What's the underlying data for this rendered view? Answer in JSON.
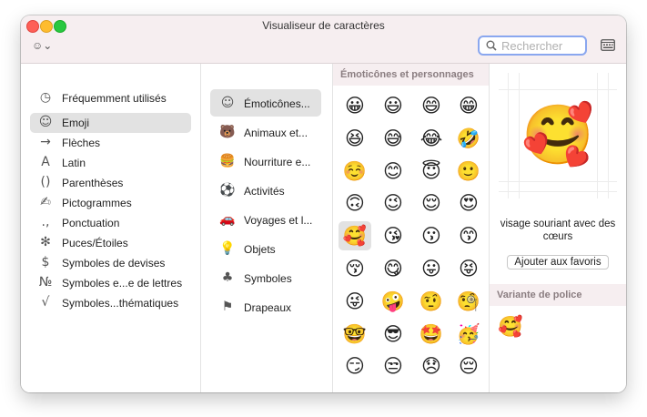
{
  "window": {
    "title": "Visualiseur de caractères"
  },
  "toolbar": {
    "emoji_menu": "☺⌄",
    "search_placeholder": "Rechercher",
    "search_value": ""
  },
  "categories": [
    {
      "icon": "◷",
      "label": "Fréquemment utilisés"
    },
    {
      "icon": "☺",
      "label": "Emoji"
    },
    {
      "icon": "→",
      "label": "Flèches"
    },
    {
      "icon": "A",
      "label": "Latin"
    },
    {
      "icon": "()",
      "label": "Parenthèses"
    },
    {
      "icon": "✍",
      "label": "Pictogrammes"
    },
    {
      "icon": ".,",
      "label": "Ponctuation"
    },
    {
      "icon": "✻",
      "label": "Puces/Étoiles"
    },
    {
      "icon": "$",
      "label": "Symboles de devises"
    },
    {
      "icon": "№",
      "label": "Symboles e...e de lettres"
    },
    {
      "icon": "√",
      "label": "Symboles...thématiques"
    }
  ],
  "subcategories": [
    {
      "icon": "☺",
      "label": "Émoticônes..."
    },
    {
      "icon": "🐻",
      "label": "Animaux et..."
    },
    {
      "icon": "🍔",
      "label": "Nourriture e..."
    },
    {
      "icon": "⚽",
      "label": "Activités"
    },
    {
      "icon": "🚗",
      "label": "Voyages et l..."
    },
    {
      "icon": "💡",
      "label": "Objets"
    },
    {
      "icon": "♣",
      "label": "Symboles"
    },
    {
      "icon": "⚑",
      "label": "Drapeaux"
    }
  ],
  "grid": {
    "section_title": "Émoticônes et personnages",
    "emojis": [
      "😀",
      "😃",
      "😄",
      "😁",
      "😆",
      "😅",
      "😂",
      "🤣",
      "☺️",
      "😊",
      "😇",
      "🙂",
      "🙃",
      "😉",
      "😌",
      "😍",
      "🥰",
      "😘",
      "😗",
      "😙",
      "😚",
      "😋",
      "😛",
      "😝",
      "😜",
      "🤪",
      "🤨",
      "🧐",
      "🤓",
      "😎",
      "🤩",
      "🥳",
      "😏",
      "😒",
      "😞",
      "😔"
    ]
  },
  "preview": {
    "emoji": "🥰",
    "name": "visage souriant avec des cœurs",
    "favorites_button": "Ajouter aux favoris",
    "variant_title": "Variante de police",
    "variant_emoji": "🥰"
  }
}
